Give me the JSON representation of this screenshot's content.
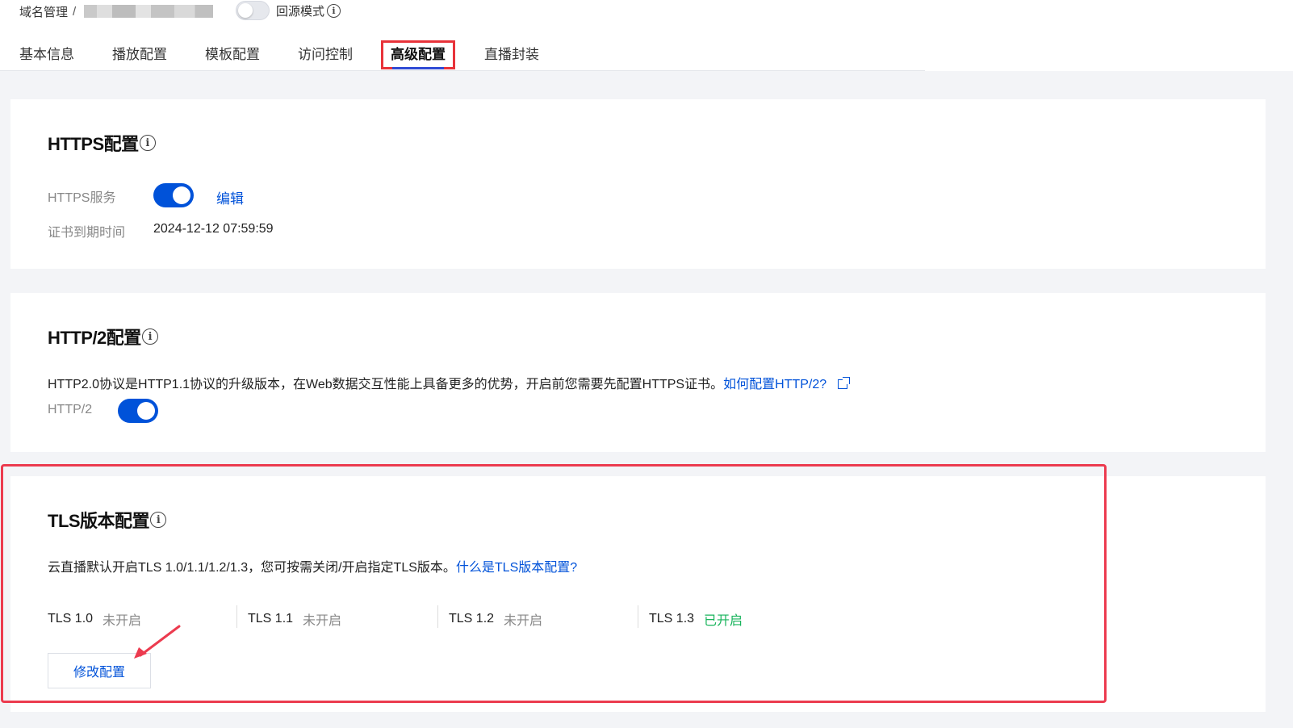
{
  "breadcrumb": {
    "root": "域名管理",
    "separator": "/"
  },
  "mode_toggle": {
    "label": "回源模式"
  },
  "tabs": [
    {
      "label": "基本信息"
    },
    {
      "label": "播放配置"
    },
    {
      "label": "模板配置"
    },
    {
      "label": "访问控制"
    },
    {
      "label": "高级配置",
      "active": true
    },
    {
      "label": "直播封装"
    }
  ],
  "https_card": {
    "title": "HTTPS配置",
    "service_label": "HTTPS服务",
    "service_enabled": true,
    "edit_link": "编辑",
    "cert_expiry_label": "证书到期时间",
    "cert_expiry_value": "2024-12-12 07:59:59"
  },
  "http2_card": {
    "title": "HTTP/2配置",
    "description": "HTTP2.0协议是HTTP1.1协议的升级版本，在Web数据交互性能上具备更多的优势，开启前您需要先配置HTTPS证书。",
    "help_link": "如何配置HTTP/2?",
    "toggle_label": "HTTP/2",
    "toggle_enabled": true
  },
  "tls_card": {
    "title": "TLS版本配置",
    "description": "云直播默认开启TLS 1.0/1.1/1.2/1.3，您可按需关闭/开启指定TLS版本。",
    "help_link": "什么是TLS版本配置?",
    "versions": [
      {
        "name": "TLS 1.0",
        "status": "未开启",
        "enabled": false
      },
      {
        "name": "TLS 1.1",
        "status": "未开启",
        "enabled": false
      },
      {
        "name": "TLS 1.2",
        "status": "未开启",
        "enabled": false
      },
      {
        "name": "TLS 1.3",
        "status": "已开启",
        "enabled": true
      }
    ],
    "modify_button": "修改配置"
  },
  "colors": {
    "primary": "#0052d9",
    "enabled_status": "#19b45c",
    "highlight": "#ec3b4f"
  }
}
